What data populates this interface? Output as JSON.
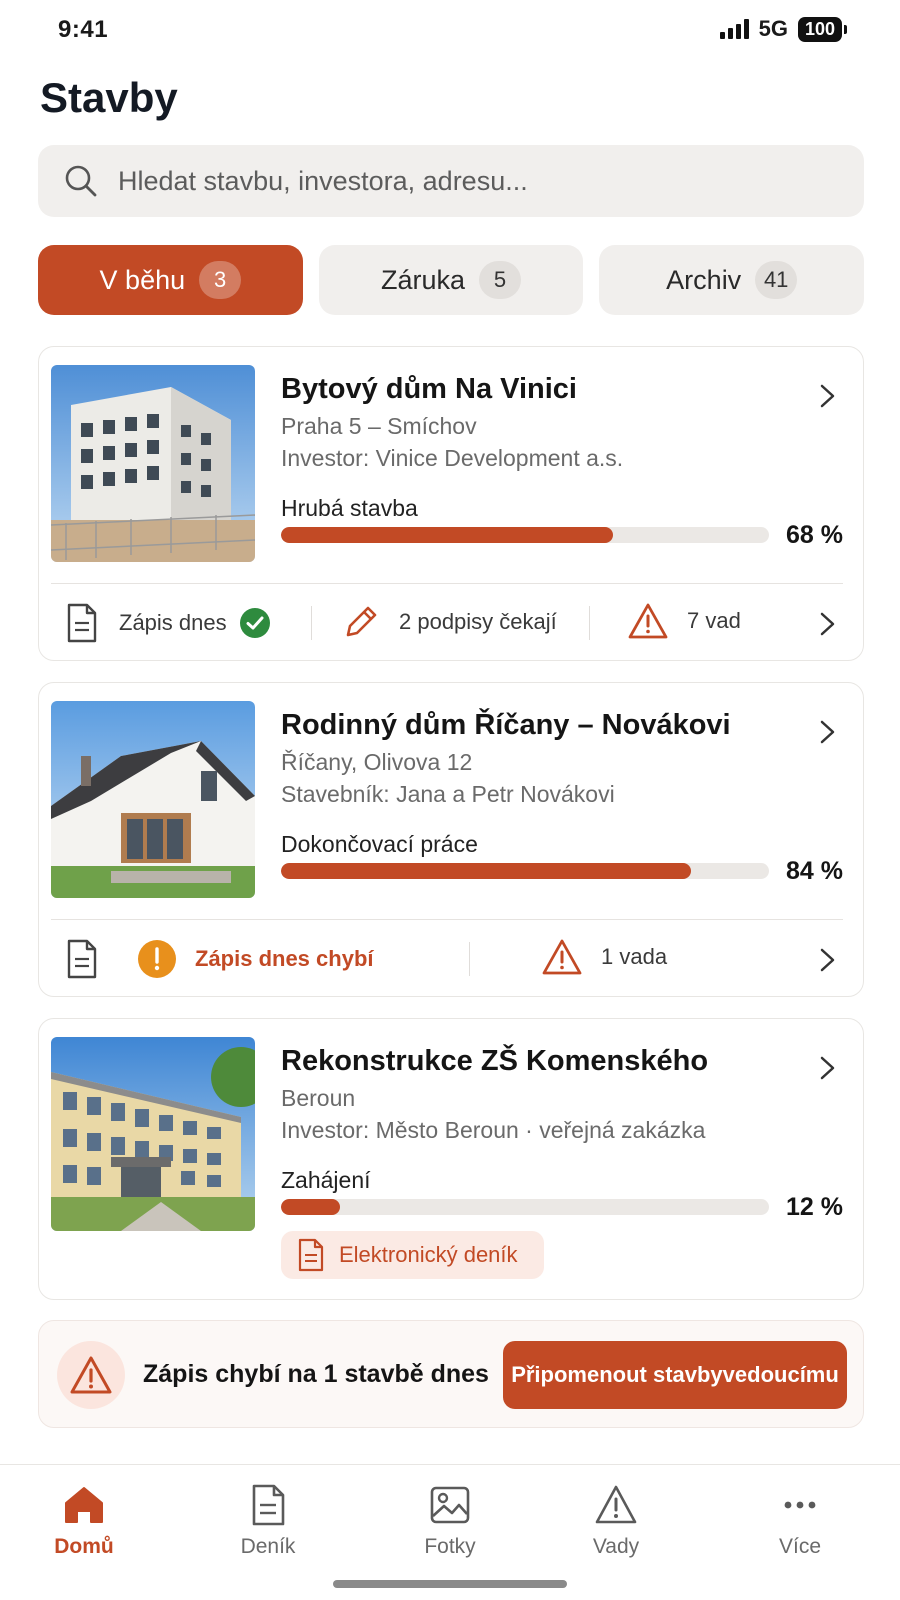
{
  "status_bar": {
    "time": "9:41",
    "network": "5G",
    "battery": "100"
  },
  "page_title": "Stavby",
  "search": {
    "placeholder": "Hledat stavbu, investora, adresu..."
  },
  "tabs": [
    {
      "label": "V běhu",
      "count": "3",
      "active": true
    },
    {
      "label": "Záruka",
      "count": "5",
      "active": false
    },
    {
      "label": "Archiv",
      "count": "41",
      "active": false
    }
  ],
  "projects": [
    {
      "title": "Bytový dům Na Vinici",
      "location": "Praha 5 – Smíchov",
      "investor": "Investor: Vinice Development a.s.",
      "phase": "Hrubá stavba",
      "progress": 68,
      "progress_label": "68 %",
      "diary_status": "Zápis dnes",
      "signatures": "2 podpisy čekají",
      "defects": "7 vad"
    },
    {
      "title": "Rodinný dům Říčany – Novákovi",
      "location": "Říčany, Olivova 12",
      "investor": "Stavebník: Jana a Petr Novákovi",
      "phase": "Dokončovací práce",
      "progress": 84,
      "progress_label": "84 %",
      "diary_status": "Zápis dnes chybí",
      "defects": "1 vada"
    },
    {
      "title": "Rekonstrukce ZŠ Komenského",
      "location": "Beroun",
      "investor": "Investor: Město Beroun · veřejná zakázka",
      "phase": "Zahájení",
      "progress": 12,
      "progress_label": "12 %",
      "tag": "Elektronický deník"
    }
  ],
  "alert": {
    "text": "Zápis chybí na 1 stavbě dnes",
    "button": "Připomenout stavbyvedoucímu"
  },
  "nav": [
    {
      "label": "Domů",
      "icon": "home-icon",
      "active": true
    },
    {
      "label": "Deník",
      "icon": "document-icon",
      "active": false
    },
    {
      "label": "Fotky",
      "icon": "photo-icon",
      "active": false
    },
    {
      "label": "Vady",
      "icon": "warning-icon",
      "active": false
    },
    {
      "label": "Více",
      "icon": "more-icon",
      "active": false
    }
  ],
  "colors": {
    "accent": "#c24a25",
    "success": "#2e8b3e",
    "warning": "#e8901c",
    "surface": "#f1efed"
  }
}
